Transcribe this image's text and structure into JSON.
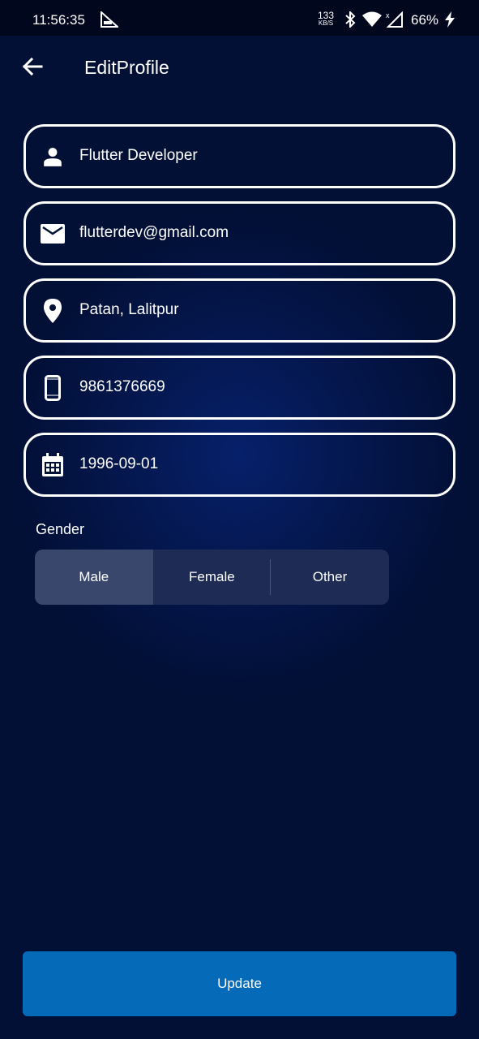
{
  "status_bar": {
    "time": "11:56:35",
    "net_speed_value": "133",
    "net_speed_unit": "KB/S",
    "battery": "66%",
    "icons": [
      "app-notification-icon",
      "bluetooth-icon",
      "wifi-icon",
      "signal-icon",
      "charging-icon"
    ]
  },
  "app_bar": {
    "title": "EditProfile",
    "back_icon": "arrow-back-icon"
  },
  "form": {
    "name": {
      "value": "Flutter Developer",
      "icon": "person-icon"
    },
    "email": {
      "value": "flutterdev@gmail.com",
      "icon": "email-icon"
    },
    "address": {
      "value": "Patan, Lalitpur",
      "icon": "location-pin-icon"
    },
    "phone": {
      "value": "9861376669",
      "icon": "smartphone-icon"
    },
    "dob": {
      "value": "1996-09-01",
      "icon": "calendar-icon"
    }
  },
  "gender": {
    "label": "Gender",
    "options": [
      "Male",
      "Female",
      "Other"
    ],
    "selected": "Male"
  },
  "update_button": {
    "label": "Update"
  },
  "colors": {
    "background": "#021035",
    "status_bar": "#01081e",
    "field_border": "#ffffff",
    "segment_bg": "#1d2b55",
    "segment_selected": "#39476d",
    "accent_button": "#056bb9"
  }
}
